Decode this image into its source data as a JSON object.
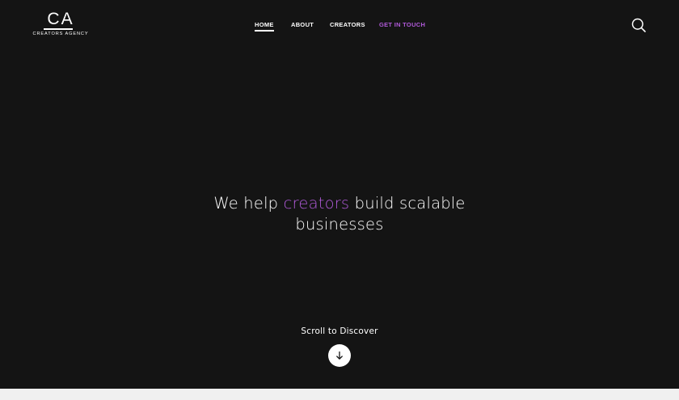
{
  "logo": {
    "mark": "CA",
    "subtitle": "CREATORS AGENCY"
  },
  "nav": {
    "items": [
      {
        "label": "HOME",
        "active": true
      },
      {
        "label": "ABOUT",
        "active": false
      },
      {
        "label": "CREATORS",
        "active": false
      },
      {
        "label": "GET IN TOUCH",
        "active": false
      }
    ]
  },
  "search": {
    "icon": "search-icon"
  },
  "hero": {
    "headline_pre": "We help ",
    "headline_accent": "creators",
    "headline_post": " build scalable businesses",
    "scroll_label": "Scroll to Discover",
    "scroll_icon": "arrow-down-icon"
  },
  "colors": {
    "background": "#141414",
    "accent": "#b05ad9",
    "text": "#ffffff"
  }
}
